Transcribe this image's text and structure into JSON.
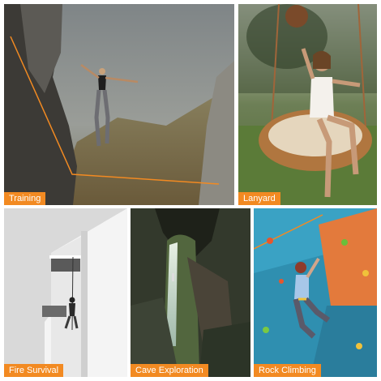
{
  "panels": {
    "training": {
      "label": "Training"
    },
    "lanyard": {
      "label": "Lanyard"
    },
    "fire_survival": {
      "label": "Fire Survival"
    },
    "cave_exploration": {
      "label": "Cave Exploration"
    },
    "rock_climbing": {
      "label": "Rock Climbing"
    }
  },
  "colors": {
    "label_bg": "#f28a22",
    "rope": "#f28a22",
    "background": "#ffffff"
  }
}
